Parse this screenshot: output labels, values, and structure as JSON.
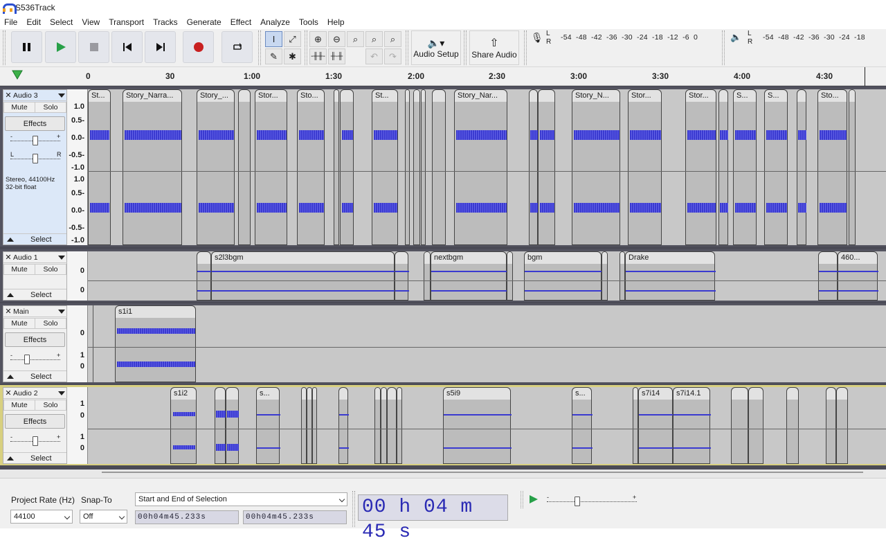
{
  "window": {
    "title": "S536Track"
  },
  "menu": [
    "File",
    "Edit",
    "Select",
    "View",
    "Transport",
    "Tracks",
    "Generate",
    "Effect",
    "Analyze",
    "Tools",
    "Help"
  ],
  "toolbar": {
    "audio_setup": "Audio Setup",
    "share_audio": "Share Audio",
    "rec_meter": {
      "l": "L",
      "r": "R",
      "scale": "-54  -48  -42  -36  -30  -24  -18  -12  -6  0"
    },
    "play_meter": {
      "l": "L",
      "r": "R",
      "scale": "-54  -48  -42  -36  -30  -24  -18"
    }
  },
  "ruler": {
    "ticks": [
      "0",
      "30",
      "1:00",
      "1:30",
      "2:00",
      "2:30",
      "3:00",
      "3:30",
      "4:00",
      "4:30"
    ]
  },
  "tracks": [
    {
      "name": "Audio 3",
      "mute": "Mute",
      "solo": "Solo",
      "effects": "Effects",
      "select": "Select",
      "info": "Stereo, 44100Hz\n32-bit float",
      "scale_top": [
        "1.0",
        "0.5-",
        "0.0-",
        "-0.5-",
        "-1.0"
      ],
      "scale_bottom": [
        "1.0",
        "0.5-",
        "0.0-",
        "-0.5-",
        "-1.0"
      ],
      "clips": [
        "St...",
        "Story_Narra...",
        "Story_...",
        "Stor...",
        "Sto...",
        "St...",
        "Story_Nar...",
        "Story_N...",
        "Stor...",
        "Stor...",
        "S...",
        "S...",
        "Sto..."
      ]
    },
    {
      "name": "Audio 1",
      "mute": "Mute",
      "solo": "Solo",
      "select": "Select",
      "clips": [
        "s2l3bgm",
        "nextbgm",
        "bgm",
        "Drake",
        "460..."
      ]
    },
    {
      "name": "Main",
      "mute": "Mute",
      "solo": "Solo",
      "effects": "Effects",
      "select": "Select",
      "clips": [
        "s1i1"
      ]
    },
    {
      "name": "Audio 2",
      "mute": "Mute",
      "solo": "Solo",
      "effects": "Effects",
      "select": "Select",
      "clips": [
        "s1i2",
        "s...",
        "s5i9",
        "s...",
        "s7i14",
        "s7i14.1"
      ]
    }
  ],
  "status": {
    "project_rate_label": "Project Rate (Hz)",
    "project_rate": "44100",
    "snap_to_label": "Snap-To",
    "snap_to": "Off",
    "selection_mode": "Start and End of Selection",
    "sel_start": "00h04m45.233s",
    "sel_end": "00h04m45.233s",
    "time": "00 h 04 m 45 s"
  },
  "colors": {
    "waveform": "#3a3ad0",
    "record": "#c82020",
    "play": "#27a048",
    "ruler_play": "#3cb048"
  }
}
